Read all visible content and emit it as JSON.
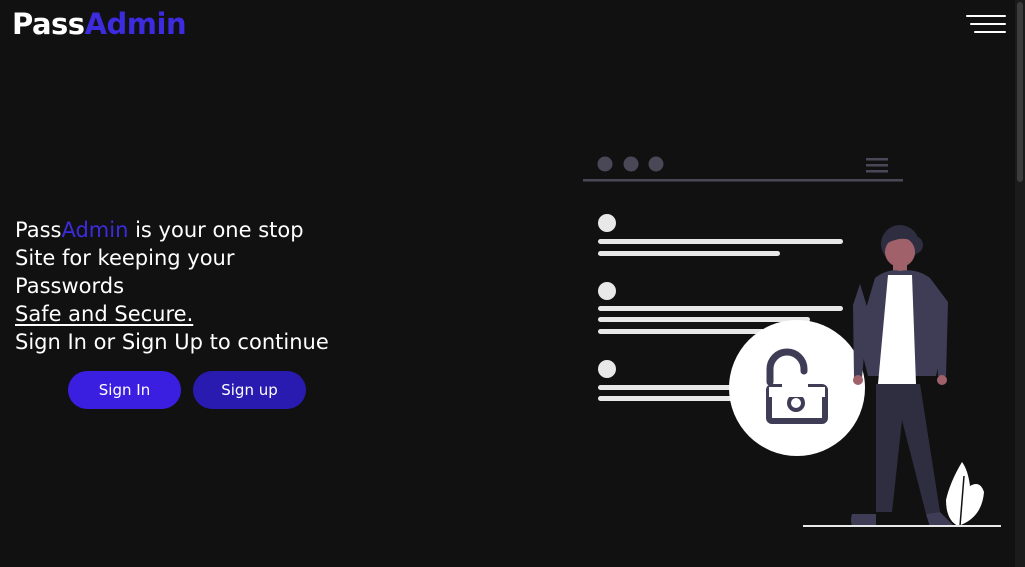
{
  "header": {
    "logo_part1": "Pass",
    "logo_part2": "Admin"
  },
  "hero": {
    "brand_part1": "Pass",
    "brand_part2": "Admin",
    "line1_rest": " is your one stop",
    "line2": "Site for keeping your",
    "line3": "Passwords",
    "line4": "Safe and Secure.",
    "line5": "Sign In or Sign Up to continue"
  },
  "buttons": {
    "sign_in": "Sign In",
    "sign_up": "Sign up"
  },
  "colors": {
    "background": "#111111",
    "brand_accent": "#3d2be0",
    "sign_in_button": "#3a1fe0",
    "sign_up_button": "#2a1bb0"
  },
  "icons": {
    "menu": "hamburger-menu-icon",
    "illustration": "person-unlocked-padlock-illustration"
  }
}
